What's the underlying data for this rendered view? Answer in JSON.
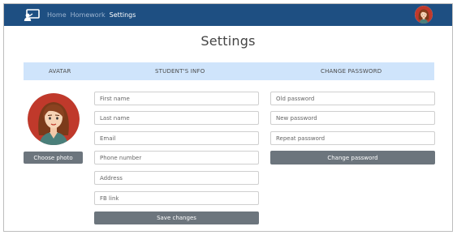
{
  "navbar": {
    "links": [
      {
        "label": "Home",
        "active": false
      },
      {
        "label": "Homework",
        "active": false
      },
      {
        "label": "Settings",
        "active": true
      }
    ],
    "logo_icon": "classroom-presentation-icon",
    "user_avatar": "user-avatar"
  },
  "page": {
    "title": "Settings"
  },
  "tabs": {
    "avatar": "AVATAR",
    "students_info": "STUDENT'S INFO",
    "change_password": "CHANGE PASSWORD"
  },
  "avatar_section": {
    "choose_photo_label": "Choose photo"
  },
  "student_info": {
    "first_name_placeholder": "First name",
    "last_name_placeholder": "Last name",
    "email_placeholder": "Email",
    "phone_placeholder": "Phone number",
    "address_placeholder": "Address",
    "fb_link_placeholder": "FB link",
    "save_label": "Save changes"
  },
  "password_section": {
    "old_placeholder": "Old password",
    "new_placeholder": "New password",
    "repeat_placeholder": "Repeat password",
    "submit_label": "Change password"
  },
  "colors": {
    "navbar": "#1e4f82",
    "tabs_bar": "#cfe4fb",
    "button": "#6c757d",
    "avatar_bg": "#c0392b"
  }
}
